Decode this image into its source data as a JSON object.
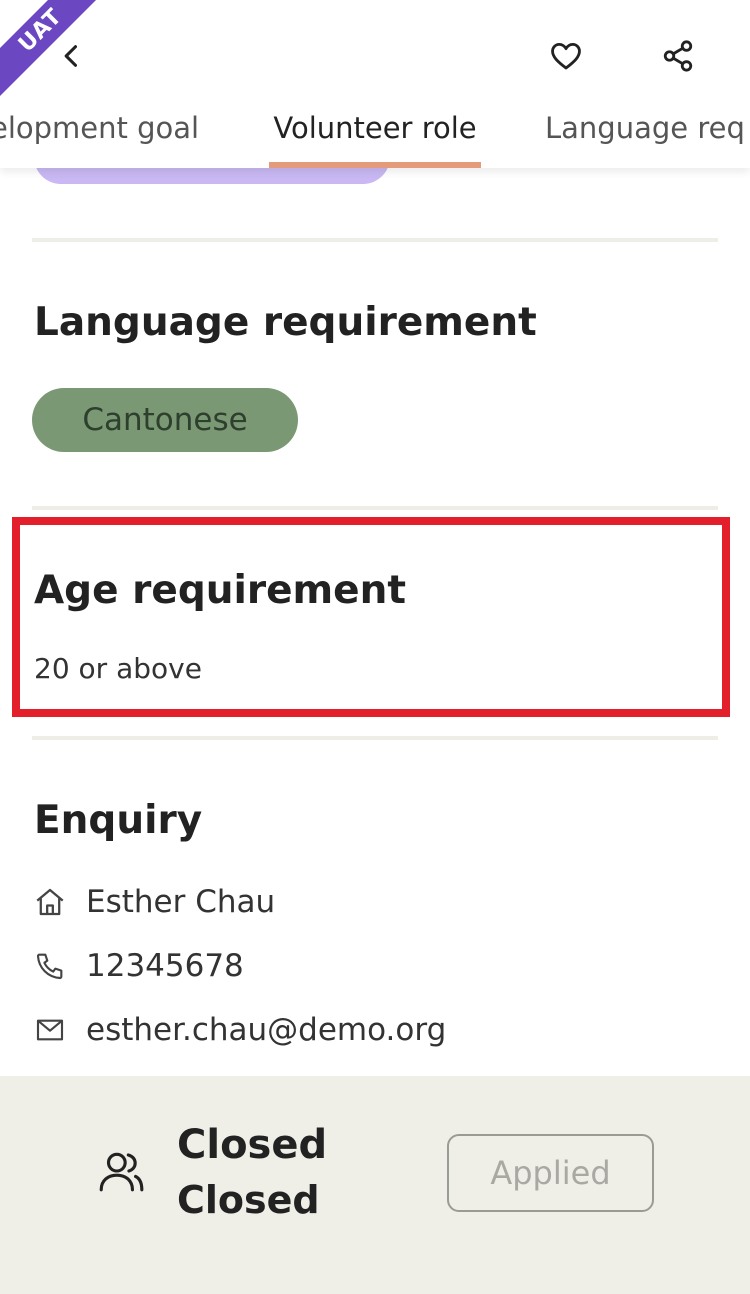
{
  "header": {
    "ribbon_text": "UAT",
    "back_icon": "chevron-left-icon",
    "favorite_icon": "heart-icon",
    "share_icon": "share-icon"
  },
  "tabs": [
    {
      "label": "elopment goal",
      "active": false
    },
    {
      "label": "Volunteer role",
      "active": true
    },
    {
      "label": "Language req",
      "active": false
    }
  ],
  "language": {
    "title": "Language requirement",
    "chips": [
      "Cantonese"
    ]
  },
  "age": {
    "title": "Age requirement",
    "value": "20 or above"
  },
  "enquiry": {
    "title": "Enquiry",
    "contact_name": "Esther Chau",
    "phone": "12345678",
    "email": "esther.chau@demo.org"
  },
  "bottom": {
    "status_line1": "Closed",
    "status_line2": "Closed",
    "applied_label": "Applied"
  },
  "colors": {
    "ribbon": "#6b47c1",
    "tab_underline": "#e39b7b",
    "language_chip": "#7a9874",
    "highlight": "#e21f2a",
    "bottom_bar": "#efeee7"
  }
}
